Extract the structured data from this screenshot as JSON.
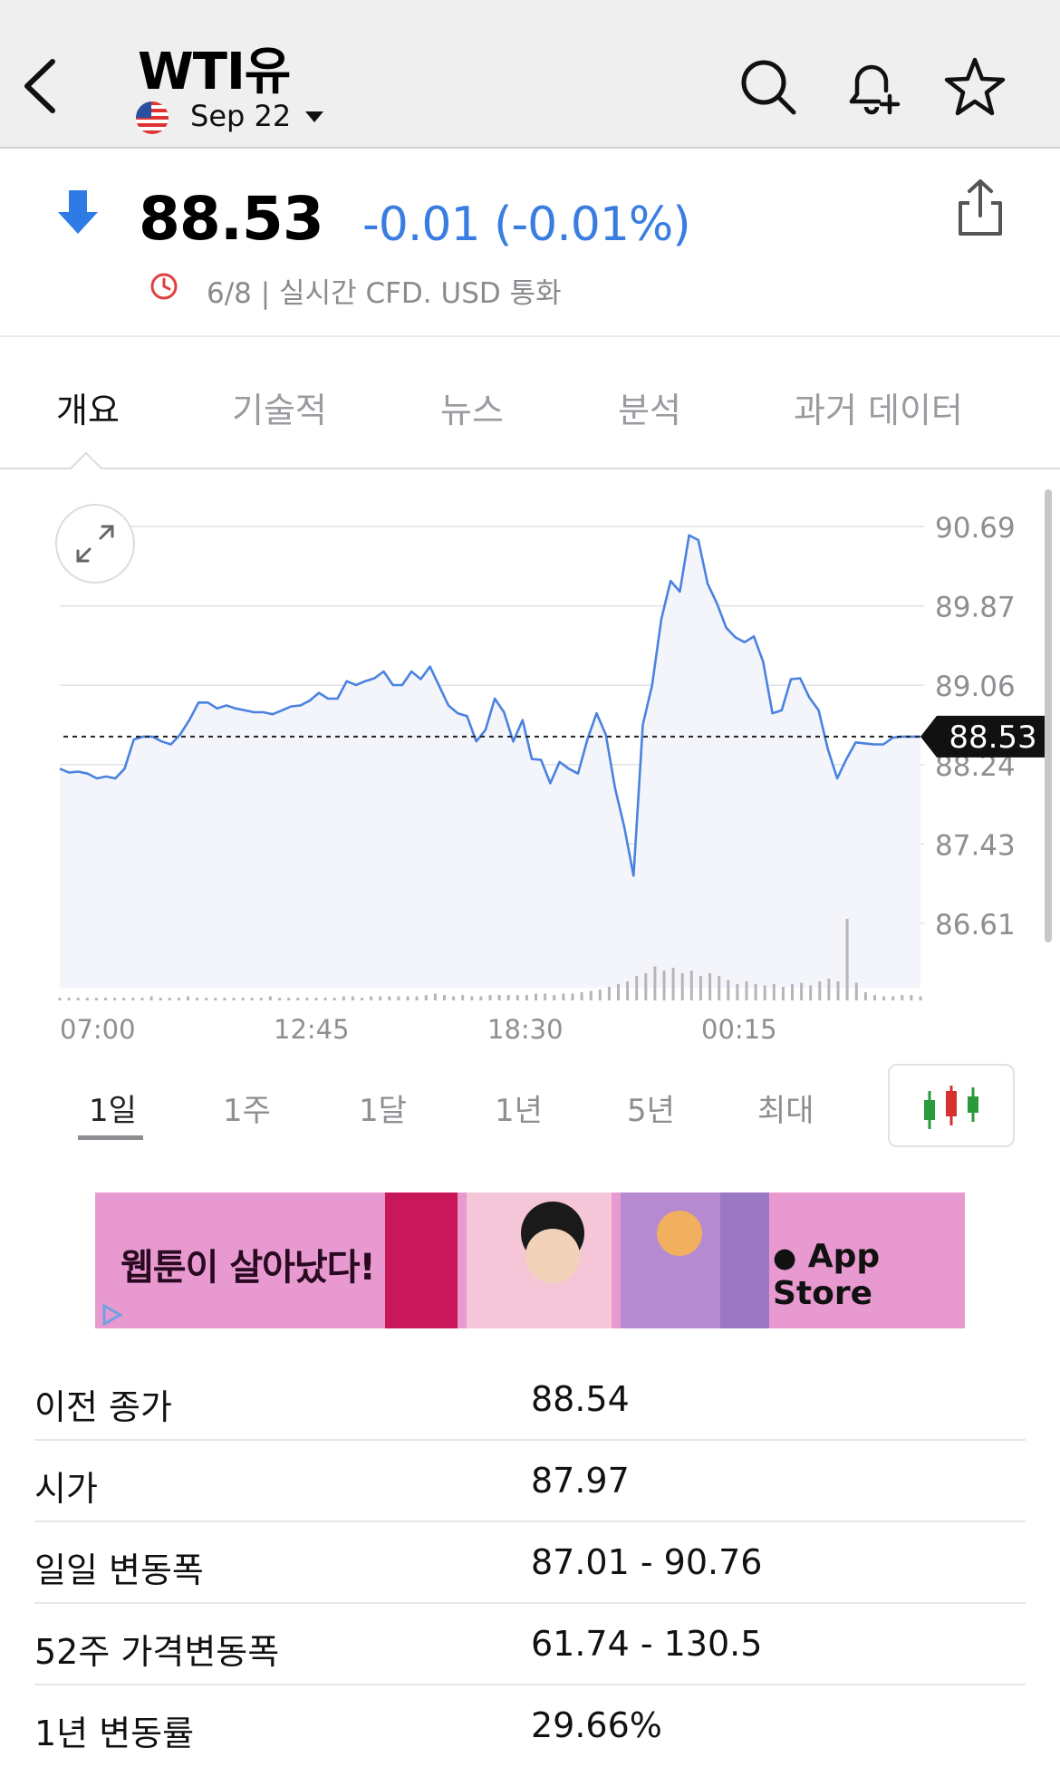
{
  "header": {
    "title": "WTI유",
    "expiry": "Sep 22",
    "icons": [
      "back-chevron-icon",
      "search-icon",
      "bell-plus-icon",
      "star-icon"
    ]
  },
  "quote": {
    "price": "88.53",
    "change": "-0.01 (-0.01%)",
    "info": "6/8 | 실시간 CFD. USD 통화",
    "change_color": "#3a7de0"
  },
  "tabs": [
    {
      "label": "개요",
      "active": true
    },
    {
      "label": "기술적",
      "active": false
    },
    {
      "label": "뉴스",
      "active": false
    },
    {
      "label": "분석",
      "active": false
    },
    {
      "label": "과거 데이터",
      "active": false
    }
  ],
  "chart_data": {
    "type": "area",
    "y_ticks": [
      "90.69",
      "89.87",
      "89.06",
      "88.24",
      "87.43",
      "86.61"
    ],
    "x_ticks": [
      "07:00",
      "12:45",
      "18:30",
      "00:15"
    ],
    "ylim": [
      86.61,
      90.69
    ],
    "current_value_label": "88.53",
    "current_value": 88.53,
    "series": [
      {
        "values": [
          88.2,
          88.16,
          88.17,
          88.15,
          88.1,
          88.12,
          88.1,
          88.2,
          88.5,
          88.53,
          88.53,
          88.48,
          88.45,
          88.55,
          88.7,
          88.88,
          88.88,
          88.82,
          88.85,
          88.82,
          88.8,
          88.78,
          88.78,
          88.76,
          88.8,
          88.84,
          88.85,
          88.9,
          88.98,
          88.92,
          88.92,
          89.1,
          89.06,
          89.1,
          89.13,
          89.2,
          89.06,
          89.06,
          89.2,
          89.12,
          89.25,
          89.05,
          88.85,
          88.77,
          88.74,
          88.48,
          88.6,
          88.92,
          88.78,
          88.48,
          88.7,
          88.3,
          88.29,
          88.05,
          88.27,
          88.2,
          88.15,
          88.5,
          88.77,
          88.55,
          88.0,
          87.6,
          87.1,
          88.65,
          89.06,
          89.74,
          90.13,
          90.02,
          90.6,
          90.55,
          90.1,
          89.9,
          89.65,
          89.55,
          89.5,
          89.56,
          89.3,
          88.77,
          88.8,
          89.12,
          89.13,
          88.93,
          88.8,
          88.4,
          88.1,
          88.3,
          88.47,
          88.46,
          88.45,
          88.45,
          88.52,
          88.53,
          88.53,
          88.53
        ]
      }
    ],
    "volume": [
      2,
      2,
      2,
      2,
      2,
      2,
      2,
      2,
      2,
      2,
      3,
      2,
      2,
      2,
      3,
      2,
      2,
      2,
      2,
      2,
      2,
      2,
      2,
      3,
      2,
      2,
      2,
      2,
      2,
      2,
      2,
      3,
      3,
      2,
      3,
      3,
      3,
      3,
      3,
      3,
      4,
      5,
      4,
      3,
      4,
      3,
      3,
      4,
      4,
      4,
      4,
      4,
      5,
      5,
      4,
      5,
      5,
      6,
      7,
      8,
      10,
      12,
      14,
      18,
      20,
      25,
      22,
      24,
      20,
      22,
      18,
      20,
      18,
      15,
      12,
      14,
      12,
      11,
      12,
      10,
      12,
      13,
      11,
      14,
      16,
      14,
      60,
      13,
      6,
      4,
      3,
      3,
      4,
      4,
      3
    ]
  },
  "ranges": [
    {
      "label": "1일",
      "active": true
    },
    {
      "label": "1주",
      "active": false
    },
    {
      "label": "1달",
      "active": false
    },
    {
      "label": "1년",
      "active": false
    },
    {
      "label": "5년",
      "active": false
    },
    {
      "label": "최대",
      "active": false
    }
  ],
  "ad": {
    "headline": "웹툰이 살아났다!",
    "store": "App Store"
  },
  "stats": [
    {
      "label": "이전 종가",
      "value": "88.54"
    },
    {
      "label": "시가",
      "value": "87.97"
    },
    {
      "label": "일일 변동폭",
      "value": "87.01 - 90.76"
    },
    {
      "label": "52주 가격변동폭",
      "value": "61.74 - 130.5"
    },
    {
      "label": "1년 변동률",
      "value": "29.66%"
    }
  ]
}
